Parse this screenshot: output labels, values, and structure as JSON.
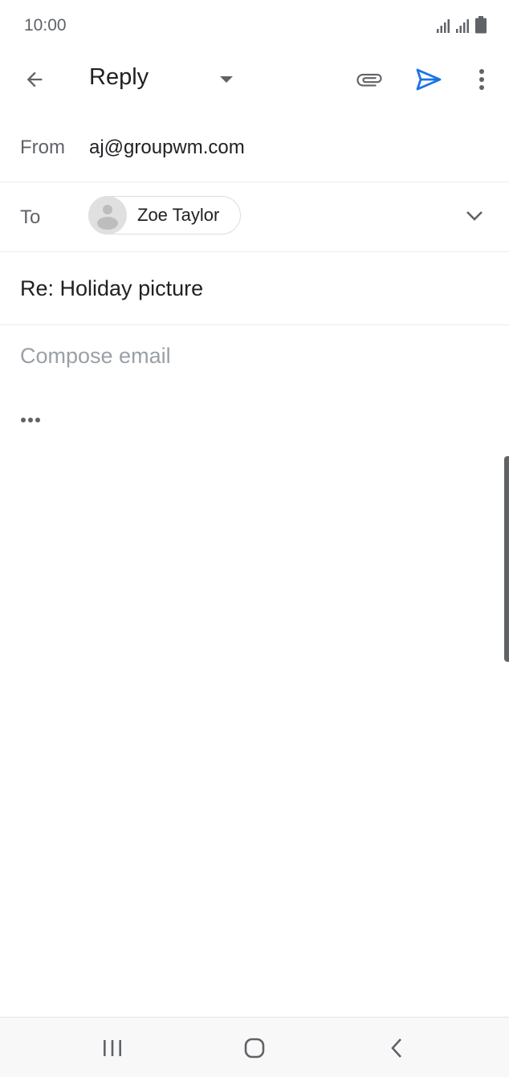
{
  "status": {
    "time": "10:00"
  },
  "appbar": {
    "title": "Reply",
    "accent": "#1a73e8"
  },
  "from": {
    "label": "From",
    "value": "aj@groupwm.com"
  },
  "to": {
    "label": "To",
    "recipient": "Zoe Taylor"
  },
  "subject": {
    "value": "Re: Holiday picture"
  },
  "body": {
    "placeholder": "Compose email"
  },
  "icons": {
    "back": "arrow-left-icon",
    "dropdown": "caret-down-icon",
    "attach": "paperclip-icon",
    "send": "send-icon",
    "more": "more-vert-icon",
    "expand": "chevron-down-icon",
    "quoted": "ellipsis-icon"
  }
}
